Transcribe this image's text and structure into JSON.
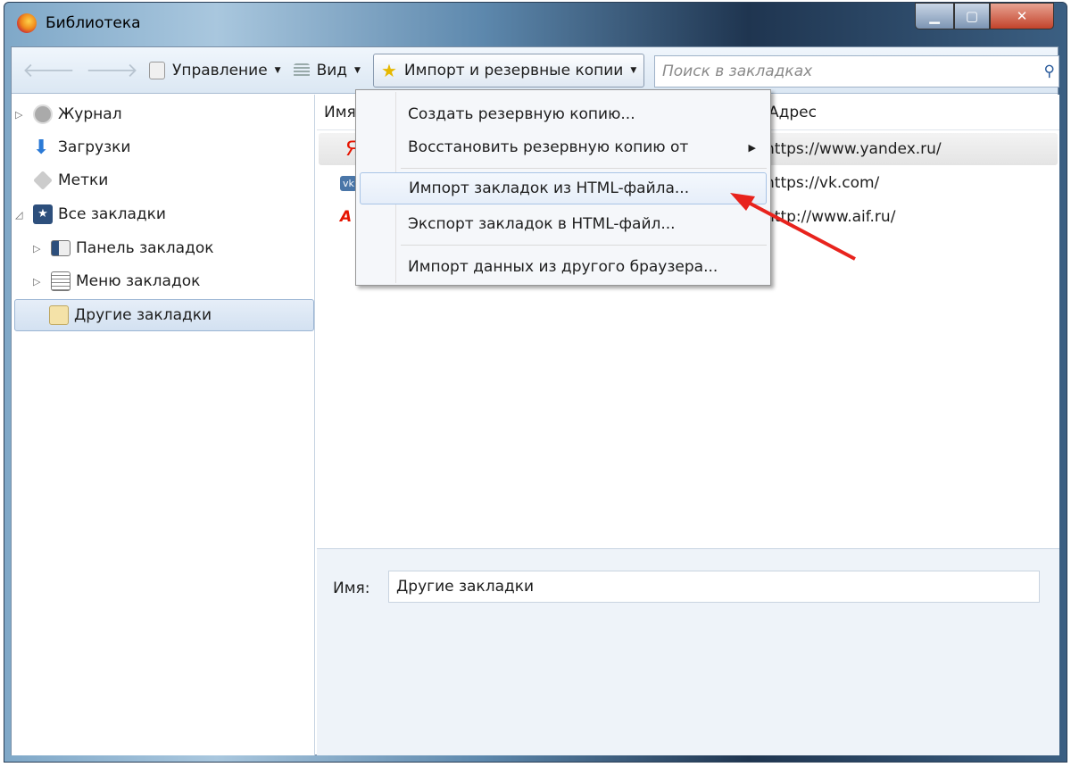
{
  "window": {
    "title": "Библиотека",
    "min": "▁",
    "max": "▢",
    "close": "✕"
  },
  "toolbar": {
    "back": "🡐",
    "forward": "🡒",
    "organize": "Управление",
    "views": "Вид",
    "import_backup": "Импорт и резервные копии",
    "search_placeholder": "Поиск в закладках"
  },
  "sidebar": {
    "items": [
      {
        "label": "Журнал",
        "icon": "clock-icon"
      },
      {
        "label": "Загрузки",
        "icon": "download-icon"
      },
      {
        "label": "Метки",
        "icon": "tag-icon"
      },
      {
        "label": "Все закладки",
        "icon": "star-icon"
      },
      {
        "label": "Панель закладок",
        "icon": "toolbar-icon"
      },
      {
        "label": "Меню закладок",
        "icon": "menu-icon"
      },
      {
        "label": "Другие закладки",
        "icon": "folder-icon"
      }
    ]
  },
  "table": {
    "headers": [
      "Имя",
      "Адрес"
    ],
    "rows": [
      {
        "icon": "Я",
        "address": "https://www.yandex.ru/"
      },
      {
        "icon": "vk",
        "address": "https://vk.com/"
      },
      {
        "icon": "A",
        "address": "http://www.aif.ru/"
      }
    ]
  },
  "details": {
    "name_label": "Имя:",
    "name_value": "Другие закладки"
  },
  "menu": {
    "items": [
      "Создать резервную копию...",
      "Восстановить резервную копию от",
      "Импорт закладок из HTML-файла...",
      "Экспорт закладок в HTML-файл...",
      "Импорт данных из другого браузера..."
    ],
    "submenu_arrow": "▶"
  },
  "colors": {
    "annotation_arrow": "#e8231d",
    "selection": "#d3e1f1"
  }
}
